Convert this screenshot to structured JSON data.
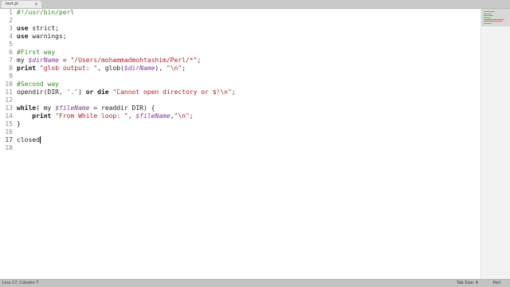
{
  "tab": {
    "title": "test.pl",
    "close": "×"
  },
  "lines": [
    {
      "n": "1",
      "parts": [
        {
          "t": "#!/usr/bin/perl",
          "c": "cm"
        }
      ]
    },
    {
      "n": "2",
      "parts": []
    },
    {
      "n": "3",
      "parts": [
        {
          "t": "use",
          "c": "kw"
        },
        {
          "t": " strict;",
          "c": ""
        }
      ]
    },
    {
      "n": "4",
      "parts": [
        {
          "t": "use",
          "c": "kw"
        },
        {
          "t": " warnings;",
          "c": ""
        }
      ]
    },
    {
      "n": "5",
      "parts": []
    },
    {
      "n": "6",
      "parts": [
        {
          "t": "#First way",
          "c": "cm"
        }
      ]
    },
    {
      "n": "7",
      "parts": [
        {
          "t": "my ",
          "c": ""
        },
        {
          "t": "$dirName",
          "c": "var"
        },
        {
          "t": " = ",
          "c": ""
        },
        {
          "t": "\"/Users/mohammadmohtashim/Perl/*\"",
          "c": "str"
        },
        {
          "t": ";",
          "c": ""
        }
      ]
    },
    {
      "n": "8",
      "parts": [
        {
          "t": "print",
          "c": "kw"
        },
        {
          "t": " ",
          "c": ""
        },
        {
          "t": "\"glob output: \"",
          "c": "str"
        },
        {
          "t": ", glob(",
          "c": ""
        },
        {
          "t": "$dirName",
          "c": "var"
        },
        {
          "t": "), ",
          "c": ""
        },
        {
          "t": "\"\\n\"",
          "c": "str"
        },
        {
          "t": ";",
          "c": ""
        }
      ]
    },
    {
      "n": "9",
      "parts": []
    },
    {
      "n": "10",
      "parts": [
        {
          "t": "#Second way",
          "c": "cm"
        }
      ]
    },
    {
      "n": "11",
      "parts": [
        {
          "t": "opendir(DIR, ",
          "c": ""
        },
        {
          "t": "'.'",
          "c": "str"
        },
        {
          "t": ") ",
          "c": ""
        },
        {
          "t": "or die",
          "c": "kw"
        },
        {
          "t": " ",
          "c": ""
        },
        {
          "t": "\"Cannot open directory or $!\\n\"",
          "c": "str"
        },
        {
          "t": ";",
          "c": ""
        }
      ]
    },
    {
      "n": "12",
      "parts": []
    },
    {
      "n": "13",
      "parts": [
        {
          "t": "while",
          "c": "kw"
        },
        {
          "t": "( my ",
          "c": ""
        },
        {
          "t": "$fileName",
          "c": "var"
        },
        {
          "t": " = readdir DIR) {",
          "c": ""
        }
      ]
    },
    {
      "n": "14",
      "parts": [
        {
          "t": "    print",
          "c": "kw"
        },
        {
          "t": " ",
          "c": ""
        },
        {
          "t": "\"From While loop: \"",
          "c": "str"
        },
        {
          "t": ", ",
          "c": ""
        },
        {
          "t": "$fileName",
          "c": "var"
        },
        {
          "t": ",",
          "c": ""
        },
        {
          "t": "\"\\n\"",
          "c": "str"
        },
        {
          "t": ";",
          "c": ""
        }
      ]
    },
    {
      "n": "15",
      "parts": [
        {
          "t": "}",
          "c": ""
        }
      ]
    },
    {
      "n": "16",
      "parts": []
    },
    {
      "n": "17",
      "parts": [
        {
          "t": "closed",
          "c": ""
        }
      ],
      "cursor": true
    },
    {
      "n": "18",
      "parts": []
    }
  ],
  "status": {
    "position": "Line 17, Column 7",
    "tab_size": "Tab Size: 4",
    "syntax": "Perl"
  }
}
